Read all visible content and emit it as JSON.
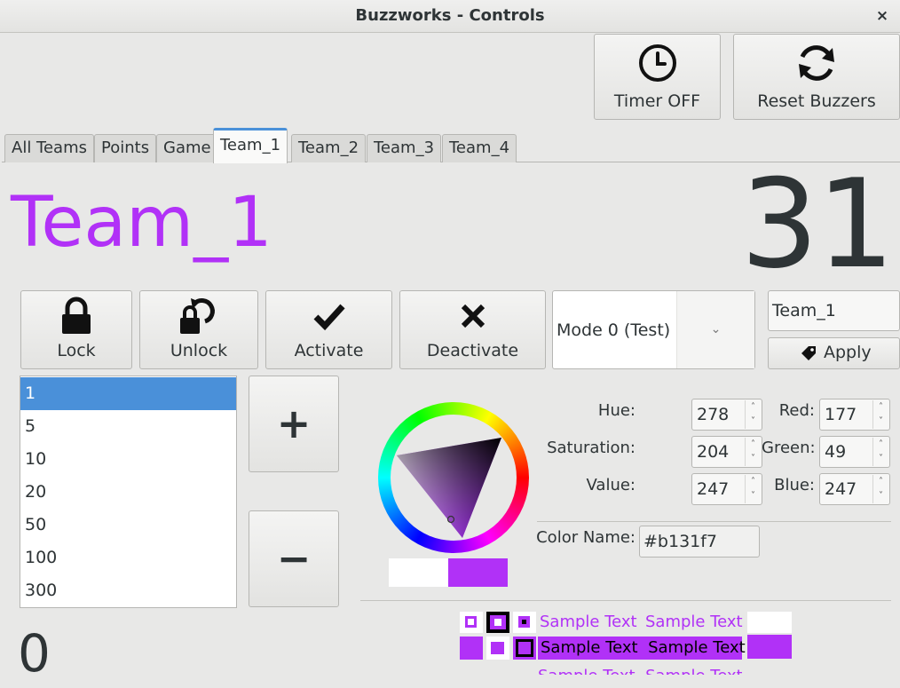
{
  "window": {
    "title": "Buzzworks - Controls",
    "close_label": "×"
  },
  "header": {
    "timer_label": "Timer OFF",
    "reset_label": "Reset Buzzers"
  },
  "tabs": [
    {
      "label": "All Teams"
    },
    {
      "label": "Points"
    },
    {
      "label": "Game"
    },
    {
      "label": "Team_1"
    },
    {
      "label": "Team_2"
    },
    {
      "label": "Team_3"
    },
    {
      "label": "Team_4"
    }
  ],
  "active_tab": "Team_1",
  "team": {
    "name": "Team_1",
    "score": "31",
    "color": "#b131f7"
  },
  "actions": {
    "lock": "Lock",
    "unlock": "Unlock",
    "activate": "Activate",
    "deactivate": "Deactivate"
  },
  "mode": {
    "selected": "Mode 0 (Test)"
  },
  "rename": {
    "value": "Team_1",
    "apply_label": "Apply"
  },
  "points_list": {
    "items": [
      "1",
      "5",
      "10",
      "20",
      "50",
      "100",
      "300"
    ],
    "selected": "1"
  },
  "stepper": {
    "plus": "+",
    "minus": "−"
  },
  "points_value": "0",
  "color_selector": {
    "hue_label": "Hue:",
    "hue": "278",
    "saturation_label": "Saturation:",
    "saturation": "204",
    "value_label": "Value:",
    "value": "247",
    "red_label": "Red:",
    "red": "177",
    "green_label": "Green:",
    "green": "49",
    "blue_label": "Blue:",
    "blue": "247",
    "name_label": "Color Name:",
    "name": "#b131f7",
    "previous_color": "#ffffff",
    "current_color": "#b131f7"
  },
  "samples": {
    "text": "Sample Text"
  },
  "icons": {
    "timer": "clock-icon",
    "reset": "refresh-icon",
    "lock": "lock-icon",
    "unlock": "unlock-icon",
    "activate": "check-icon",
    "deactivate": "x-icon",
    "apply": "tag-icon",
    "dropdown": "chevron-down-icon"
  }
}
